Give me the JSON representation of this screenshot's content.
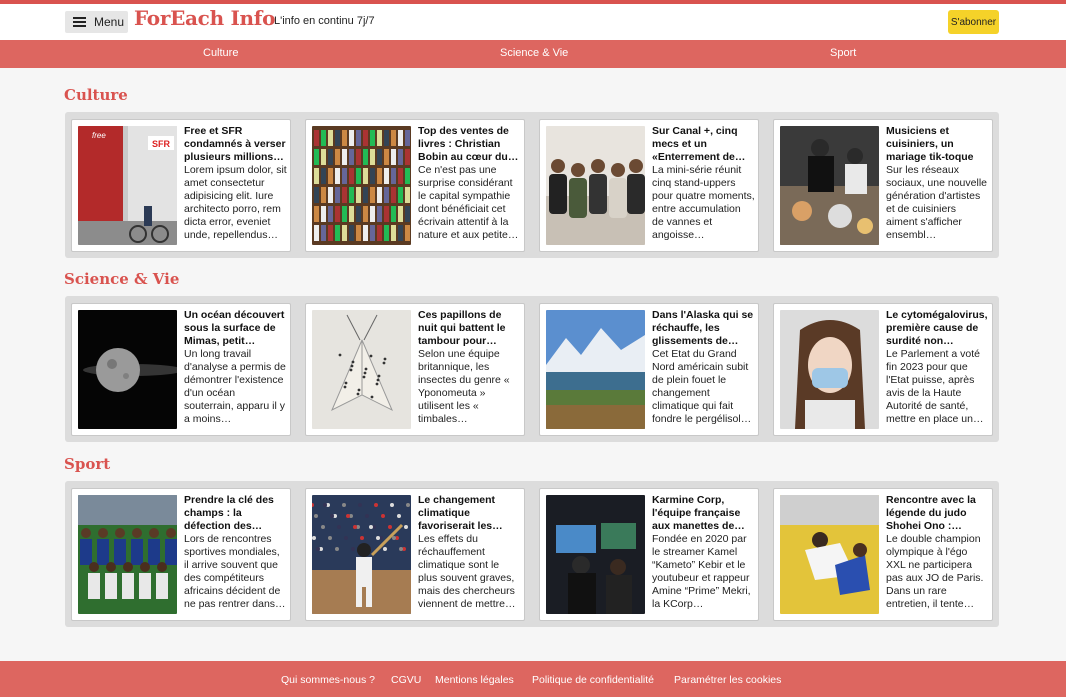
{
  "header": {
    "menu_label": "Menu",
    "logo": "ForEach Info",
    "tagline": "L'info en continu 7j/7",
    "subscribe_label": "S'abonner"
  },
  "colors": {
    "brand_red": "#d9534f",
    "nav_red": "#dd6660",
    "subscribe_yellow": "#f5d229"
  },
  "nav": [
    "Culture",
    "Science & Vie",
    "Sport"
  ],
  "sections": [
    {
      "title": "Culture",
      "articles": [
        {
          "image": "street-shop-photo",
          "title": "Free et SFR condamnés à verser plusieurs millions…",
          "summary": "Lorem ipsum dolor, sit amet consectetur adipisicing elit. Iure architecto porro, rem dicta error, eveniet unde, repellendus…"
        },
        {
          "image": "bookshelf-photo",
          "title": "Top des ventes de livres : Christian Bobin au cœur du…",
          "summary": "Ce n'est pas une surprise considérant le capital sympathie dont bénéficiait cet écrivain attentif à la nature et aux petite…"
        },
        {
          "image": "comedians-photo",
          "title": "Sur Canal +, cinq mecs et un «Enterrement de vi…",
          "summary": "La mini-série réunit cinq stand-uppers pour quatre moments, entre accumulation de vannes et angoisse…"
        },
        {
          "image": "kitchen-photo",
          "title": "Musiciens et cuisiniers, un mariage tik-toque",
          "summary": "Sur les réseaux sociaux, une nouvelle génération d'artistes et de cuisiniers aiment s'afficher ensembl…"
        }
      ]
    },
    {
      "title": "Science & Vie",
      "articles": [
        {
          "image": "mimas-moon-photo",
          "title": "Un océan découvert sous la surface de Mimas, petit satelli…",
          "summary": "Un long travail d'analyse a permis de démontrer l'existence d'un océan souterrain, apparu il y a moins…"
        },
        {
          "image": "moth-photo",
          "title": "Ces papillons de nuit qui battent le tambour pour…",
          "summary": "Selon une équipe britannique, les insectes du genre « Yponomeuta » utilisent les « timbales…"
        },
        {
          "image": "alaska-landscape-photo",
          "title": "Dans l'Alaska qui se réchauffe, les glissements de…",
          "summary": "Cet Etat du Grand Nord américain subit de plein fouet le changement climatique qui fait fondre le pergélisol…"
        },
        {
          "image": "masked-woman-photo",
          "title": "Le cytomégalovirus, première cause de surdité non…",
          "summary": "Le Parlement a voté fin 2023 pour que l'Etat puisse, après avis de la Haute Autorité de santé, mettre en place un…"
        }
      ]
    },
    {
      "title": "Sport",
      "articles": [
        {
          "image": "football-team-photo",
          "title": "Prendre la clé des champs : la défection des…",
          "summary": "Lors de rencontres sportives mondiales, il arrive souvent que des compétiteurs africains décident de ne pas rentrer dans…"
        },
        {
          "image": "baseball-photo",
          "title": "Le changement climatique favoriserait les…",
          "summary": "Les effets du réchauffement climatique sont le plus souvent graves, mais des chercheurs viennent de mettre…"
        },
        {
          "image": "esports-photo",
          "title": "Karmine Corp, l'équipe française aux manettes de…",
          "summary": "Fondée en 2020 par le streamer Kamel “Kameto” Kebir et le youtubeur et rappeur Amine “Prime” Mekri, la KCorp…"
        },
        {
          "image": "judo-photo",
          "title": "Rencontre avec la légende du judo Shohei Ono :…",
          "summary": "Le double champion olympique à l'égo XXL ne participera pas aux JO de Paris. Dans un rare entretien, il tente…"
        }
      ]
    }
  ],
  "footer": [
    "Qui sommes-nous ?",
    "CGVU",
    "Mentions légales",
    "Politique de confidentialité",
    "Paramétrer les cookies"
  ]
}
